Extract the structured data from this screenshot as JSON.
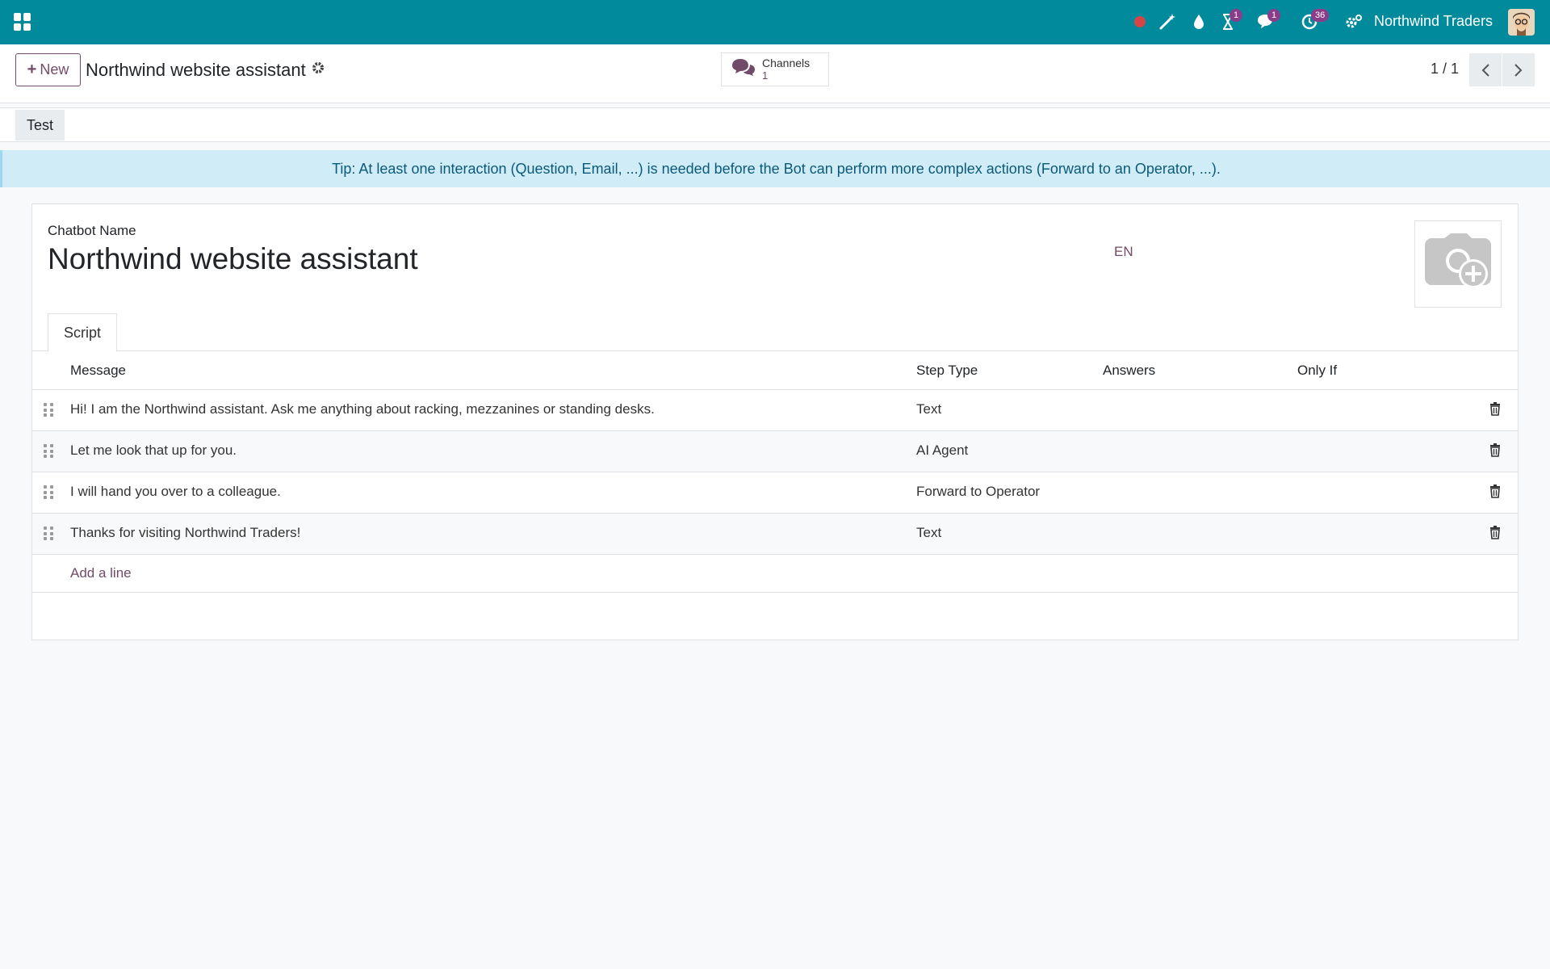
{
  "navbar": {
    "company": "Northwind Traders",
    "badges": {
      "activity_timer": "1",
      "messages": "1",
      "activities": "36"
    },
    "colors": {
      "navbar": "#018a9b",
      "accent": "#714b67",
      "recording_dot": "#d64545"
    }
  },
  "control_panel": {
    "new_label": "New",
    "breadcrumb": "Northwind website assistant",
    "smart_button": {
      "label": "Channels",
      "value": "1"
    },
    "pager": "1 / 1"
  },
  "statusbar": {
    "test_label": "Test"
  },
  "alert": "Tip: At least one interaction (Question, Email, ...) is needed before the Bot can perform more complex actions (Forward to an Operator, ...).",
  "form": {
    "name_label": "Chatbot Name",
    "name_value": "Northwind website assistant",
    "lang": "EN"
  },
  "tabs": [
    {
      "label": "Script"
    }
  ],
  "table": {
    "headers": {
      "message": "Message",
      "step_type": "Step Type",
      "answers": "Answers",
      "only_if": "Only If"
    },
    "rows": [
      {
        "message": "Hi! I am the Northwind assistant. Ask me anything about racking, mezzanines or standing desks.",
        "step_type": "Text",
        "answers": "",
        "only_if": ""
      },
      {
        "message": "Let me look that up for you.",
        "step_type": "AI Agent",
        "answers": "",
        "only_if": ""
      },
      {
        "message": "I will hand you over to a colleague.",
        "step_type": "Forward to Operator",
        "answers": "",
        "only_if": ""
      },
      {
        "message": "Thanks for visiting Northwind Traders!",
        "step_type": "Text",
        "answers": "",
        "only_if": ""
      }
    ],
    "add_line": "Add a line"
  }
}
